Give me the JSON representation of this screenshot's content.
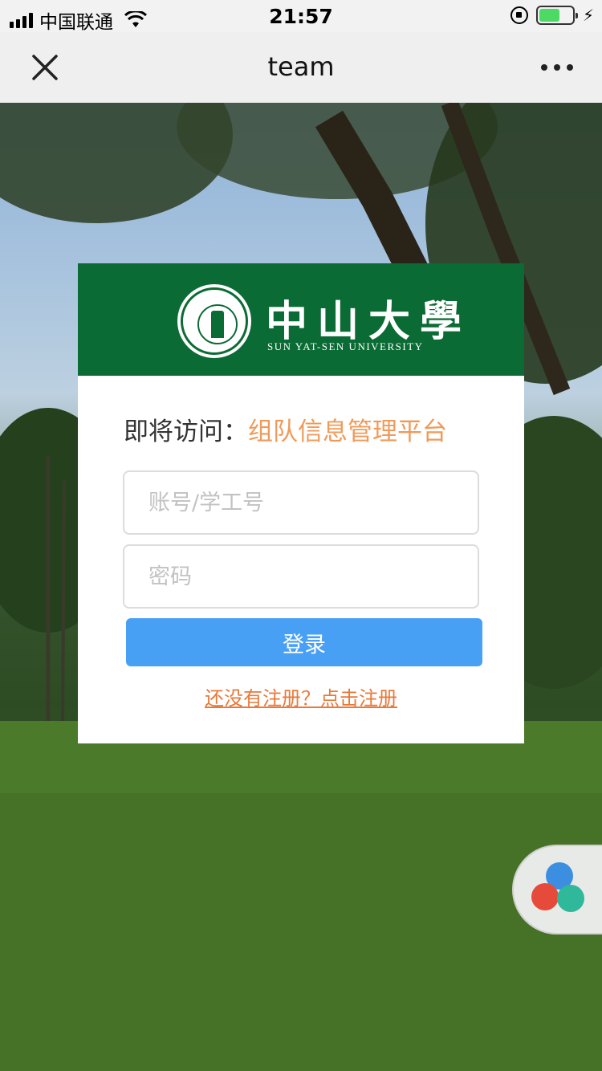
{
  "status_bar": {
    "carrier": "中国联通",
    "time": "21:57",
    "icons": [
      "signal-icon",
      "wifi-icon",
      "orientation-lock-icon",
      "battery-icon",
      "charging-icon"
    ],
    "battery_color": "#4cd964"
  },
  "nav": {
    "title": "team",
    "close_icon": "close-icon",
    "more_icon": "more-icon"
  },
  "logo": {
    "chinese_name": "中山大學",
    "english_name": "SUN YAT-SEN UNIVERSITY",
    "brand_color": "#0b6b34"
  },
  "login": {
    "visit_prefix": "即将访问：",
    "visit_target": "组队信息管理平台",
    "account_placeholder": "账号/学工号",
    "password_placeholder": "密码",
    "submit_label": "登录",
    "register_link": "还没有注册？点击注册",
    "accent_color": "#48a0f5",
    "link_color": "#e8793a"
  },
  "floating_widget": {
    "icons": [
      "hand-icon",
      "y-logo-icon",
      "book-icon"
    ]
  }
}
